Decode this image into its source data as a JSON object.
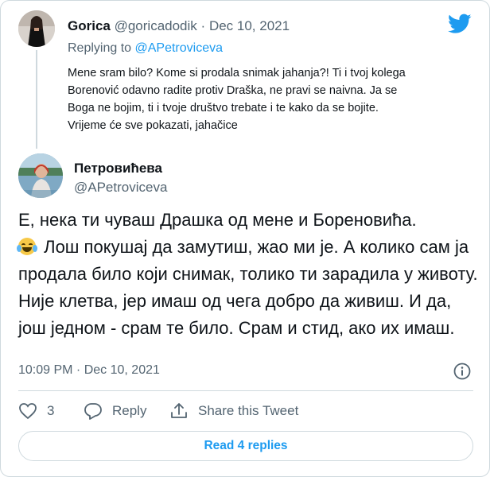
{
  "parent_tweet": {
    "name": "Gorica",
    "handle": "@goricadodik",
    "separator": "·",
    "date": "Dec 10, 2021",
    "replying_prefix": "Replying to",
    "replying_handle": "@APetroviceva",
    "text": "Mene sram bilo? Kome si prodala snimak jahanja?! Ti i tvoj kolega Borenović odavno radite protiv Draška, ne pravi se naivna. Ja se Boga ne bojim, ti i tvoje društvo trebate i te kako da se bojite. Vrijeme će sve pokazati, jahačice"
  },
  "main_tweet": {
    "name": "Петровићева",
    "handle": "@APetroviceva",
    "text_line1": "Е, нека ти чуваш Драшка од мене и Бореновића.",
    "emoji": "face-with-tears-of-joy",
    "text_rest": "Лош покушај да замутиш, жао ми је. А колико сам ја продала било који снимак, толико ти зарадила у животу. Није клетва, јер имаш од чега добро да живиш. И да, још једном - срам те било. Срам и стид, ако их имаш.",
    "timestamp": "10:09 PM · Dec 10, 2021"
  },
  "actions": {
    "like_count": "3",
    "reply_label": "Reply",
    "share_label": "Share this Tweet"
  },
  "read_replies_label": "Read 4 replies",
  "colors": {
    "accent": "#1d9bf0",
    "text": "#0f1419",
    "muted": "#536471",
    "border": "#cfd9de"
  },
  "icons": {
    "logo": "twitter-bird-icon",
    "info": "info-icon",
    "like": "heart-icon",
    "reply": "reply-bubble-icon",
    "share": "share-upload-icon"
  }
}
